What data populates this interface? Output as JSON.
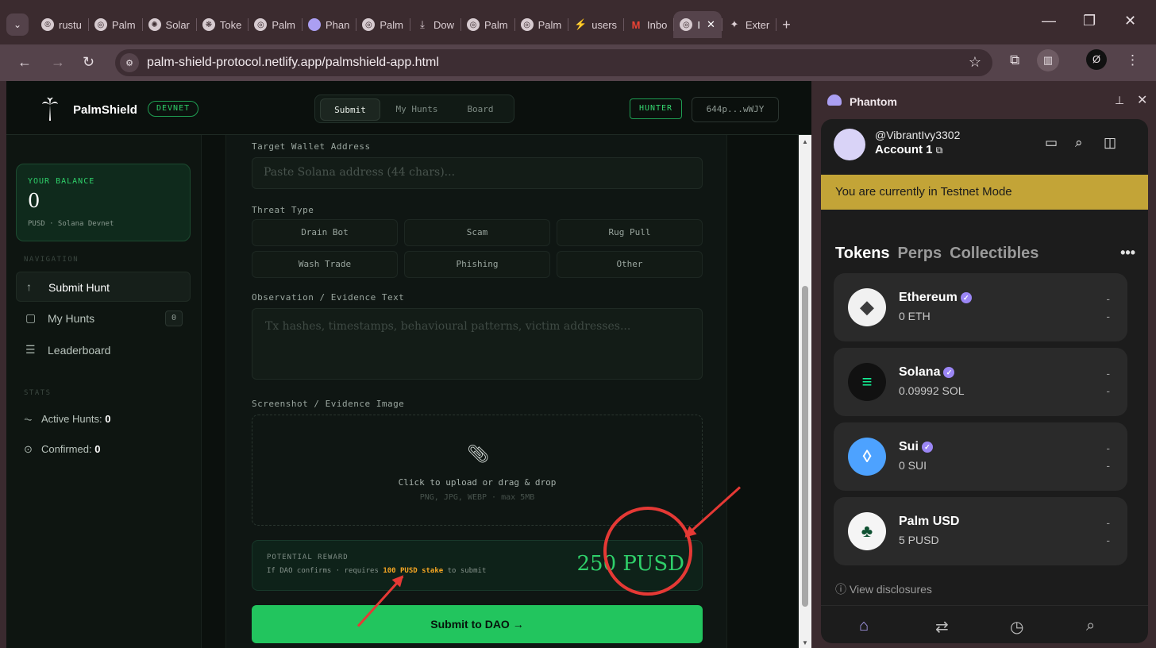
{
  "browser": {
    "tabs": [
      {
        "label": "rustu",
        "icon": "rust-icon"
      },
      {
        "label": "Palm",
        "icon": "globe-icon"
      },
      {
        "label": "Solar",
        "icon": "openai-icon"
      },
      {
        "label": "Toke",
        "icon": "token-icon"
      },
      {
        "label": "Palm",
        "icon": "globe-icon"
      },
      {
        "label": "Phan",
        "icon": "phantom-icon"
      },
      {
        "label": "Palm",
        "icon": "globe-icon"
      },
      {
        "label": "Dow",
        "icon": "download-icon"
      },
      {
        "label": "Palm",
        "icon": "globe-icon"
      },
      {
        "label": "Palm",
        "icon": "globe-icon"
      },
      {
        "label": "users",
        "icon": "bolt-icon"
      },
      {
        "label": "Inbo",
        "icon": "gmail-icon"
      },
      {
        "label": "I",
        "icon": "globe-icon"
      },
      {
        "label": "Exter",
        "icon": "puzzle-icon"
      }
    ],
    "url": "palm-shield-protocol.netlify.app/palmshield-app.html"
  },
  "app": {
    "brand": "PalmShield",
    "network_badge": "DEVNET",
    "nav_tabs": {
      "submit": "Submit",
      "my_hunts": "My Hunts",
      "board": "Board"
    },
    "role_badge": "HUNTER",
    "wallet_short": "644p...wWJY"
  },
  "sidebar": {
    "balance": {
      "label": "YOUR BALANCE",
      "value": "0",
      "sub": "PUSD · Solana Devnet"
    },
    "nav_label": "NAVIGATION",
    "items": [
      {
        "label": "Submit Hunt",
        "icon": "arrow-up-icon"
      },
      {
        "label": "My Hunts",
        "icon": "clipboard-icon",
        "count": "0"
      },
      {
        "label": "Leaderboard",
        "icon": "list-icon"
      }
    ],
    "stats_label": "STATS",
    "stats": {
      "active_label": "Active Hunts: ",
      "active_value": "0",
      "confirmed_label": "Confirmed: ",
      "confirmed_value": "0"
    }
  },
  "form": {
    "target_label": "Target Wallet Address",
    "target_placeholder": "Paste Solana address (44 chars)...",
    "threat_label": "Threat Type",
    "threats": [
      "Drain Bot",
      "Scam",
      "Rug Pull",
      "Wash Trade",
      "Phishing",
      "Other"
    ],
    "evidence_label": "Observation / Evidence Text",
    "evidence_placeholder": "Tx hashes, timestamps, behavioural patterns, victim addresses...",
    "screenshot_label": "Screenshot / Evidence Image",
    "upload_text": "Click to upload or drag & drop",
    "upload_hint": "PNG, JPG, WEBP · max 5MB",
    "reward_label": "POTENTIAL REWARD",
    "reward_sub_pre": "If DAO confirms · requires ",
    "reward_sub_bold": "100 PUSD stake",
    "reward_sub_post": " to submit",
    "reward_value": "250 PUSD",
    "submit_label": "Submit to DAO →"
  },
  "phantom": {
    "title": "Phantom",
    "username": "@VibrantIvy3302",
    "account": "Account 1",
    "testnet_banner": "You are currently in Testnet Mode",
    "tabs": [
      "Tokens",
      "Perps",
      "Collectibles"
    ],
    "tokens": [
      {
        "name": "Ethereum",
        "amount": "0 ETH",
        "d1": "-",
        "d2": "-"
      },
      {
        "name": "Solana",
        "amount": "0.09992 SOL",
        "d1": "-",
        "d2": "-"
      },
      {
        "name": "Sui",
        "amount": "0 SUI",
        "d1": "-",
        "d2": "-"
      },
      {
        "name": "Palm USD",
        "amount": "5 PUSD",
        "d1": "-",
        "d2": "-"
      }
    ],
    "disclosures": "View disclosures"
  },
  "colors": {
    "accent": "#22c55e",
    "annotation": "#e53935",
    "testnet": "#c3a437",
    "stake_highlight": "#f5a623"
  }
}
